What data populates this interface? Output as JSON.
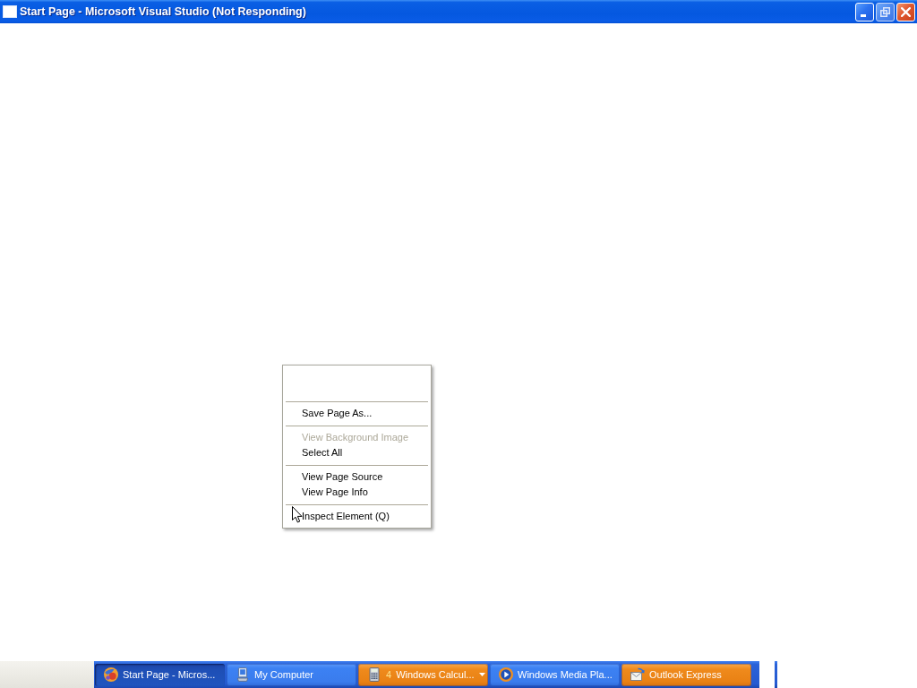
{
  "window": {
    "title": "Start Page - Microsoft Visual Studio (Not Responding)",
    "controls": [
      {
        "kind": "minimize",
        "disabled": false
      },
      {
        "kind": "restore",
        "disabled": true
      },
      {
        "kind": "close",
        "disabled": false
      }
    ]
  },
  "context_menu": {
    "groups": [
      {
        "items": [
          {
            "label": "Save Page As...",
            "disabled": false
          }
        ]
      },
      {
        "items": [
          {
            "label": "View Background Image",
            "disabled": true
          },
          {
            "label": "Select All",
            "disabled": false
          }
        ]
      },
      {
        "items": [
          {
            "label": "View Page Source",
            "disabled": false
          },
          {
            "label": "View Page Info",
            "disabled": false
          }
        ]
      },
      {
        "items": [
          {
            "label": "Inspect Element (Q)",
            "disabled": false
          }
        ]
      }
    ]
  },
  "taskbar": {
    "buttons": [
      {
        "kind": "ball",
        "label": "Start Page - Micros...",
        "selected": true,
        "flashing": false
      },
      {
        "kind": "computer",
        "label": "My Computer",
        "selected": false,
        "flashing": false
      },
      {
        "kind": "calculator",
        "count": "4",
        "label": "Windows Calcul...",
        "selected": false,
        "flashing": true
      },
      {
        "kind": "media",
        "label": "Windows Media Pla...",
        "selected": false,
        "flashing": false
      },
      {
        "kind": "mail",
        "label": "Outlook Express",
        "selected": false,
        "flashing": true
      }
    ]
  }
}
